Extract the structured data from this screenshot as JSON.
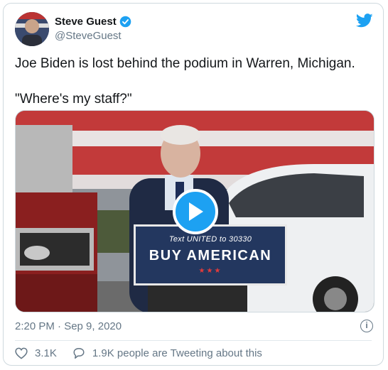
{
  "author": {
    "name": "Steve Guest",
    "handle": "@SteveGuest"
  },
  "tweet": {
    "text": "Joe Biden is lost behind the podium in Warren, Michigan.\n\n\"Where's my staff?\"",
    "timestamp": "2:20 PM · Sep 9, 2020"
  },
  "media": {
    "sign_line1": "Text UNITED to 30330",
    "sign_line2": "BUY AMERICAN",
    "sign_stars": "★★★"
  },
  "footer": {
    "likes": "3.1K",
    "conversation": "1.9K people are Tweeting about this"
  },
  "icons": {
    "info": "i"
  },
  "colors": {
    "accent": "#1da1f2",
    "muted": "#657786",
    "sign_bg": "#23375f"
  }
}
